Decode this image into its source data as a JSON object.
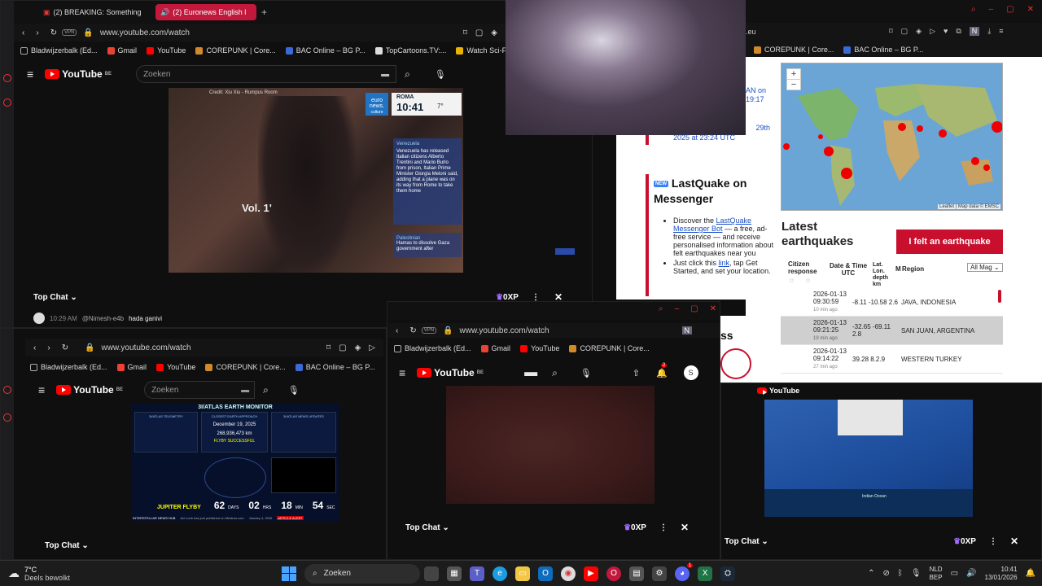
{
  "top_left": {
    "tabs": [
      {
        "label": "(2) BREAKING: Something"
      },
      {
        "label": "(2) Euronews English l"
      }
    ],
    "url": "www.youtube.com/watch",
    "vpn": "VPN",
    "bookmarks": [
      "Bladwijzerbalk (Ed...",
      "Gmail",
      "YouTube",
      "COREPUNK | Core...",
      "BAC Online – BG P...",
      "TopCartoons.TV:...",
      "Watch Sci-Fi Cart"
    ],
    "yt_logo": "YouTube",
    "yt_region": "BE",
    "search_placeholder": "Zoeken",
    "video": {
      "credit": "Credit: Xiu Xiu - Rumpus Room",
      "brand": "euro news.",
      "brand_sub": "culture",
      "city": "ROMA",
      "time": "10:41",
      "temp": "7°",
      "overlay_text": "Vol. 1'",
      "news_tag1": "Venezuela",
      "news_text1": "Venezuela has released Italian citizens Alberto Trentini and Mario Burlo from prison, Italian Prime Minister Giorgia Meloni said, adding that a plane was on its way from Rome to take them home",
      "news_tag2": "Palestinian",
      "news_text2": "Hamas to dissolve Gaza government after"
    },
    "chat": {
      "title": "Top Chat",
      "xp": "0XP",
      "msg_time": "10:29 AM",
      "msg_user": "@Nimesh-e4b",
      "msg_text": "hada ganivi"
    }
  },
  "lastquake": {
    "url_frag": ".eu",
    "bookmarks": [
      "COREPUNK | Core...",
      "BAC Online – BG P..."
    ],
    "left_links": [
      "AN on",
      "19:17",
      "29th",
      "2025 at 23:24 UTC"
    ],
    "new_badge": "NEW",
    "messenger_title": "LastQuake on Messenger",
    "bullets": [
      {
        "pre": "Discover the ",
        "link": "LastQuake Messenger Bot",
        "post": " — a free, ad-free service — and receive personalised information about felt earthquakes near you"
      },
      {
        "pre": "Just click this ",
        "link": "link",
        "post": ", tap Get Started, and set your location."
      }
    ],
    "map_attrib": "Leaflet | Map data © EMSC",
    "zoom_in": "+",
    "zoom_out": "−",
    "latest_title": "Latest earthquakes",
    "felt_button": "I felt an earthquake",
    "col_citizen": "Citizen response",
    "col_datetime": "Date & Time UTC",
    "col_latlon": "Lat. Lon. depth km",
    "col_mag": "M",
    "col_region": "Region",
    "mag_filter": "All Mag",
    "rows": [
      {
        "date": "2026-01-13",
        "time": "09:30:59",
        "ago": "10 min ago",
        "coords": "-8.11 -10.58 2.6",
        "region": "JAVA, INDONESIA"
      },
      {
        "date": "2026-01-13",
        "time": "09:21:25",
        "ago": "19 min ago",
        "coords": "-32.65 -69.11 2.8",
        "region": "SAN JUAN, ARGENTINA"
      },
      {
        "date": "2026-01-13",
        "time": "09:14:22",
        "ago": "27 min ago",
        "coords": "39.28 8.2.9",
        "region": "WESTERN TURKEY"
      },
      {
        "date": "2026-01-13",
        "time": "",
        "ago": "",
        "coords": "",
        "region": ""
      }
    ],
    "partial_word": "ss"
  },
  "bottom_left": {
    "url": "www.youtube.com/watch",
    "bookmarks": [
      "Bladwijzerbalk (Ed...",
      "Gmail",
      "YouTube",
      "COREPUNK | Core...",
      "BAC Online – BG P..."
    ],
    "search_placeholder": "Zoeken",
    "monitor": {
      "title": "3I/ATLAS EARTH MONITOR",
      "telemetry_title": "3I/ATLAS TELEMETRY",
      "approach_title": "CLOSEST EARTH APPROACH",
      "approach_date": "December 19, 2025",
      "approach_dist": "268,936,473 km",
      "flyby_status": "FLYBY SUCCESSFUL",
      "news_title": "3I/ATLAS NEWS UPDATES",
      "jupiter_title": "JUPITER FLYBY",
      "days": "62",
      "days_label": "DAYS",
      "hrs": "02",
      "hrs_label": "HRS",
      "mins": "18",
      "mins_label": "MIN",
      "secs": "54",
      "secs_label": "SEC",
      "footer": "Avi Loeb has just published on Medium.com",
      "footer_date": "January 4, 2026",
      "footer_tag": "ARTICLE ALERT",
      "brand": "INTERSTELLAR NEWS HUB"
    },
    "chat_title": "Top Chat"
  },
  "bottom_mid": {
    "url": "www.youtube.com/watch",
    "vpn": "VPN",
    "bookmarks": [
      "Bladwijzerbalk (Ed...",
      "Gmail",
      "YouTube",
      "COREPUNK | Core..."
    ],
    "notif_count": "2",
    "avatar_letter": "S",
    "chat_title": "Top Chat",
    "xp": "0XP"
  },
  "bottom_right": {
    "map_labels": [
      "Indian Ocean"
    ],
    "chat_title": "Top Chat",
    "xp": "0XP"
  },
  "taskbar": {
    "weather_temp": "7°C",
    "weather_desc": "Deels bewolkt",
    "search_placeholder": "Zoeken",
    "lang1": "NLD",
    "lang2": "BEP",
    "clock_time": "10:41",
    "clock_date": "13/01/2026",
    "discord_badge": "1"
  },
  "colors": {
    "opera_red": "#c2183b",
    "youtube_red": "#ff0000",
    "emsc_red": "#c8102e",
    "link_blue": "#1a4fc7"
  }
}
